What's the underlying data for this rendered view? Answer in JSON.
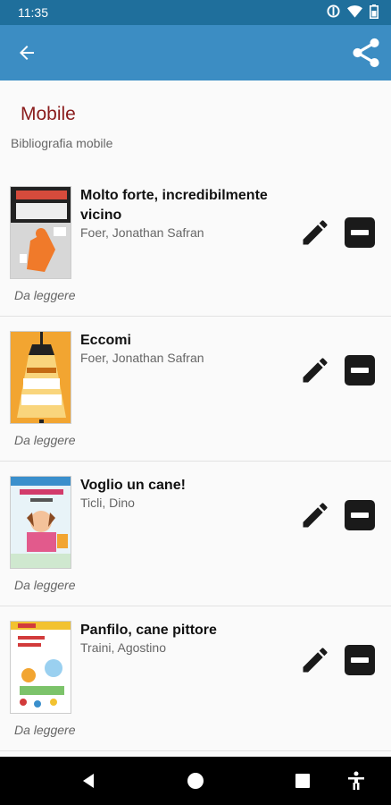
{
  "status_bar": {
    "time": "11:35"
  },
  "app_bar": {
    "back_icon": "arrow-left-icon",
    "share_icon": "share-icon"
  },
  "list": {
    "title": "Mobile",
    "subtitle": "Bibliografia mobile"
  },
  "books": [
    {
      "title": "Molto forte, incredibilmente vicino",
      "author": "Foer, Jonathan Safran",
      "status": "Da leggere"
    },
    {
      "title": "Eccomi",
      "author": "Foer, Jonathan Safran",
      "status": "Da leggere"
    },
    {
      "title": "Voglio un cane!",
      "author": "Ticli, Dino",
      "status": "Da leggere"
    },
    {
      "title": "Panfilo, cane pittore",
      "author": "Traini, Agostino",
      "status": "Da leggere"
    }
  ],
  "nav_bar": {
    "items": [
      "back-triangle-icon",
      "home-circle-icon",
      "recents-square-icon",
      "accessibility-icon"
    ]
  },
  "colors": {
    "status_bar": "#1f6f9c",
    "app_bar": "#3c8dc3",
    "title": "#8a1c1c"
  }
}
